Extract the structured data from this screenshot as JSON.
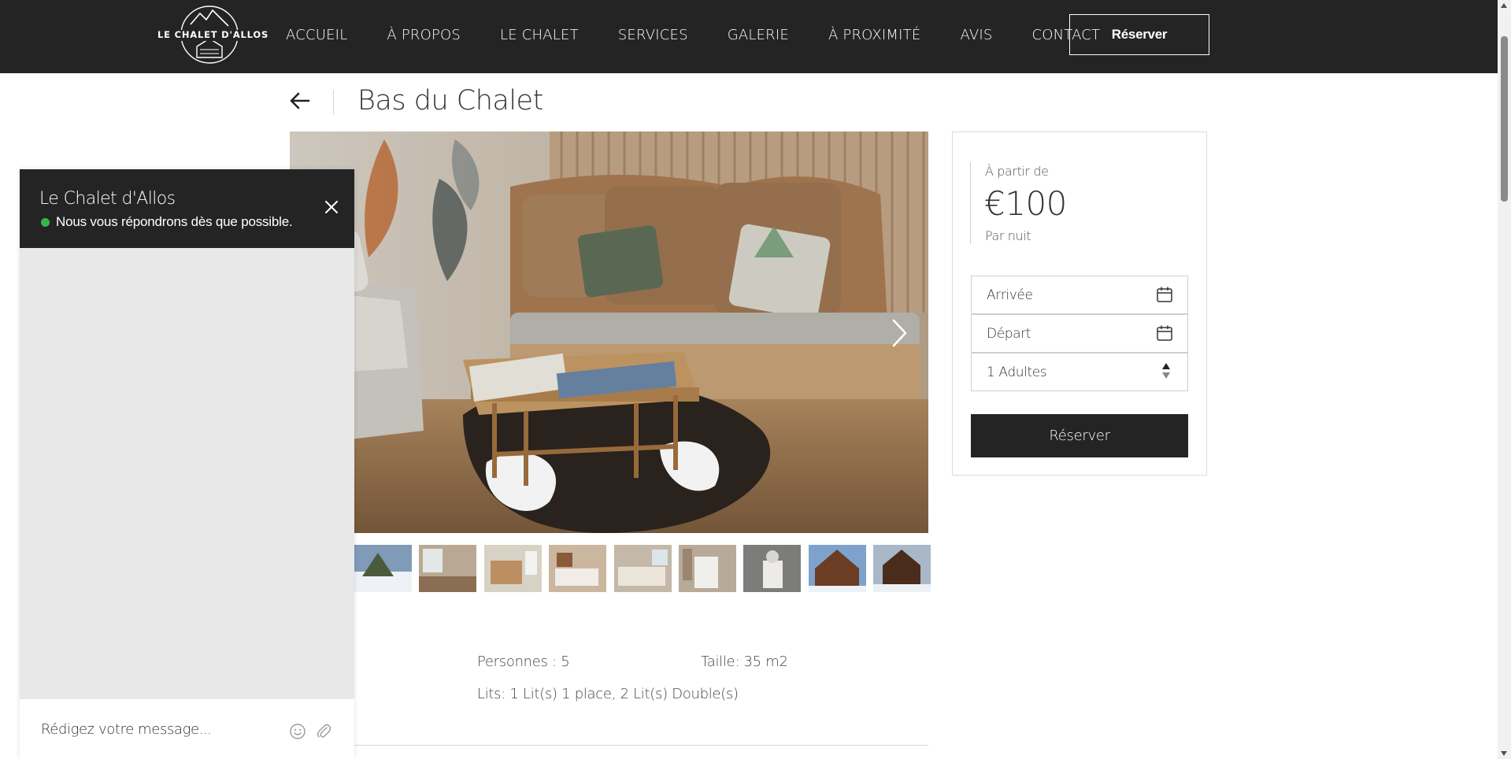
{
  "header": {
    "logo_text": "LE CHALET D'ALLOS",
    "nav": [
      "ACCUEIL",
      "À PROPOS",
      "LE CHALET",
      "SERVICES",
      "GALERIE",
      "À PROXIMITÉ",
      "AVIS",
      "CONTACT"
    ],
    "book_label": "Réserver"
  },
  "page": {
    "title": "Bas du Chalet"
  },
  "details": {
    "persons": "Personnes : 5",
    "size": "Taille: 35 m2",
    "beds": "Lits: 1 Lit(s) 1 place, 2 Lit(s) Double(s)"
  },
  "booking": {
    "from_label": "À partir de",
    "price": "€100",
    "per_night": "Par nuit",
    "arrival_label": "Arrivée",
    "departure_label": "Départ",
    "guests_value": "1 Adultes",
    "book_label": "Réserver"
  },
  "chat": {
    "title": "Le Chalet d'Allos",
    "status": "Nous vous répondrons dès que possible.",
    "compose_placeholder": "Rédigez votre message..."
  },
  "icons": {
    "back": "arrow-left-icon",
    "next": "chevron-right-icon",
    "calendar": "calendar-icon",
    "close": "close-icon",
    "emoji": "smiley-icon",
    "attach": "paperclip-icon"
  },
  "colors": {
    "header_bg": "#242424",
    "button_bg": "#242424",
    "status_green": "#3ab54a",
    "chat_body": "#e8e8e8"
  }
}
